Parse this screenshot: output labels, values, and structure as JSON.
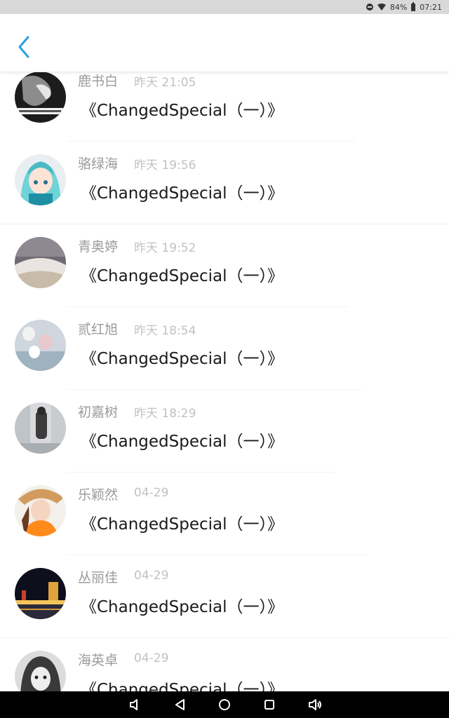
{
  "status_bar": {
    "battery": "84%",
    "time": "07:21",
    "icons": [
      "do-not-disturb-icon",
      "wifi-icon",
      "battery-icon"
    ]
  },
  "header": {
    "back_icon": "chevron-left-icon",
    "accent_color": "#2a9fe0"
  },
  "comments": [
    {
      "name": "鹿书白",
      "time": "昨天 21:05",
      "message": "《ChangedSpecial（一）》"
    },
    {
      "name": "骆绿海",
      "time": "昨天 19:56",
      "message": "《ChangedSpecial（一）》"
    },
    {
      "name": "青奥婷",
      "time": "昨天 19:52",
      "message": "《ChangedSpecial（一）》"
    },
    {
      "name": "贰红旭",
      "time": "昨天 18:54",
      "message": "《ChangedSpecial（一）》"
    },
    {
      "name": "初嘉树",
      "time": "昨天 18:29",
      "message": "《ChangedSpecial（一）》"
    },
    {
      "name": "乐颖然",
      "time": "04-29",
      "message": "《ChangedSpecial（一）》"
    },
    {
      "name": "丛丽佳",
      "time": "04-29",
      "message": "《ChangedSpecial（一）》"
    },
    {
      "name": "海英卓",
      "time": "04-29",
      "message": "《ChangedSpecial（一）》"
    }
  ],
  "nav_bar": {
    "icons": [
      "volume-down-icon",
      "back-triangle-icon",
      "home-circle-icon",
      "recents-square-icon",
      "volume-up-icon"
    ]
  }
}
